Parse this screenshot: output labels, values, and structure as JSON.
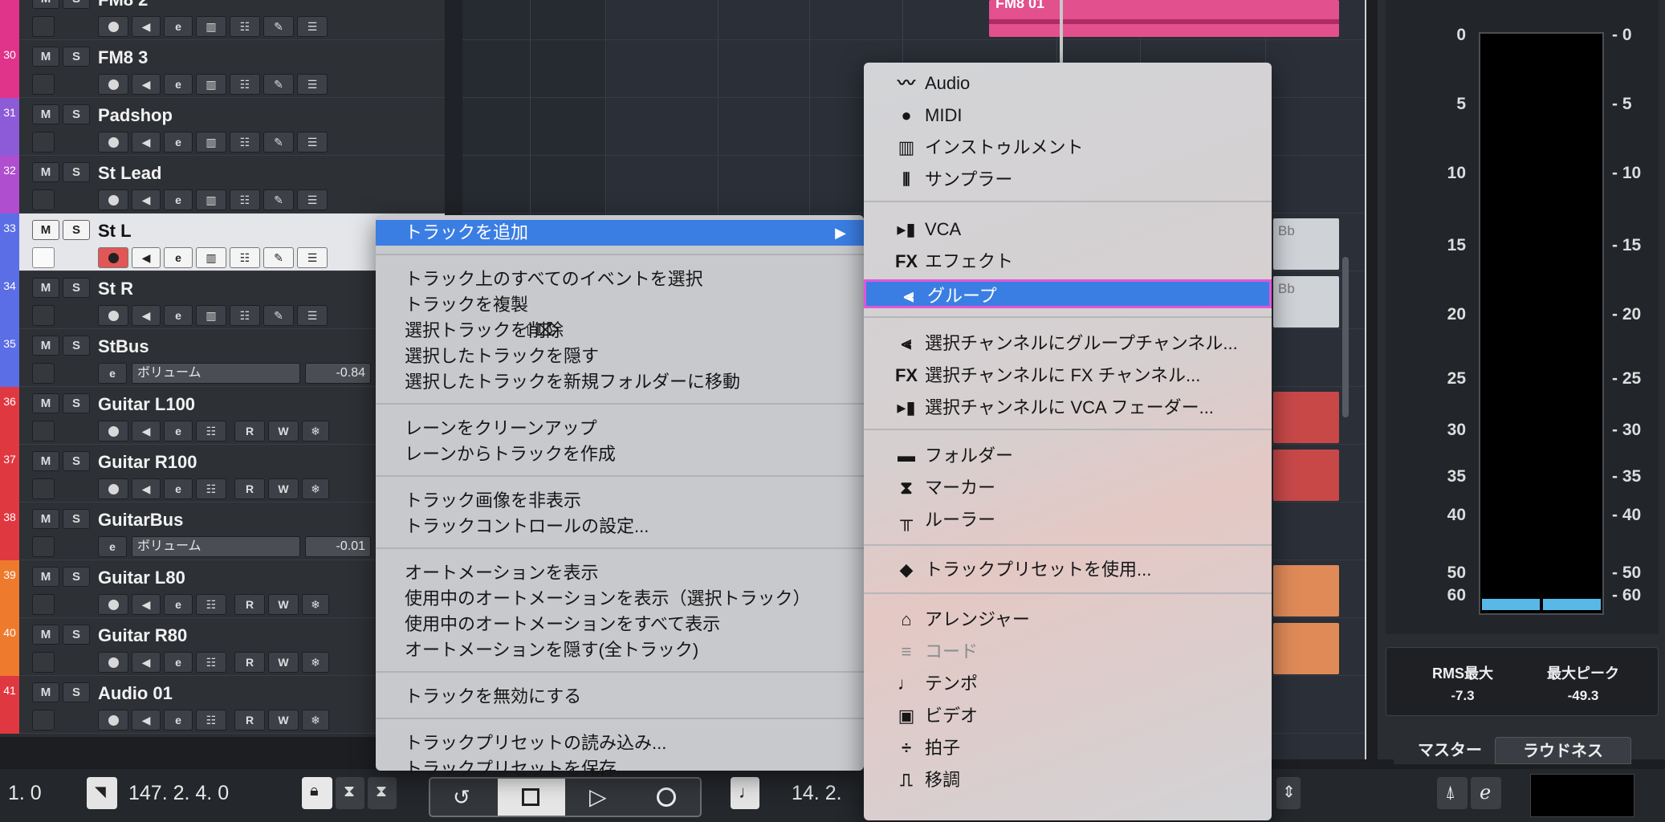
{
  "tracks": [
    {
      "num": "",
      "name": "FM8 2",
      "color": "#e0338a"
    },
    {
      "num": "30",
      "name": "FM8 3",
      "color": "#e0338a"
    },
    {
      "num": "31",
      "name": "Padshop",
      "color": "#8e5bd8"
    },
    {
      "num": "32",
      "name": "St Lead",
      "color": "#b04ed0"
    },
    {
      "num": "33",
      "name": "St L",
      "color": "#5b6ee6"
    },
    {
      "num": "34",
      "name": "St R",
      "color": "#5b6ee6"
    },
    {
      "num": "35",
      "name": "StBus",
      "color": "#5b6ee6",
      "volume_label": "ボリューム",
      "volume_value": "-0.84"
    },
    {
      "num": "36",
      "name": "Guitar L100",
      "color": "#e03840"
    },
    {
      "num": "37",
      "name": "Guitar R100",
      "color": "#e03840"
    },
    {
      "num": "38",
      "name": "GuitarBus",
      "color": "#e03840",
      "volume_label": "ボリューム",
      "volume_value": "-0.01"
    },
    {
      "num": "39",
      "name": "Guitar L80",
      "color": "#ee7a2e"
    },
    {
      "num": "40",
      "name": "Guitar R80",
      "color": "#ee7a2e"
    },
    {
      "num": "41",
      "name": "Audio 01",
      "color": "#e03840"
    }
  ],
  "track_buttons": {
    "mute": "M",
    "solo": "S",
    "e": "e",
    "read": "R",
    "write": "W"
  },
  "project": {
    "event_top_label": "FM8 01",
    "event_bb_1": "Bb",
    "event_bb_2": "Bb"
  },
  "context_menu": {
    "items": [
      {
        "label": "トラックを追加",
        "highlighted": true
      },
      {
        "label": "トラック上のすべてのイベントを選択"
      },
      {
        "label": "トラックを複製"
      },
      {
        "label": "選択トラックを削除",
        "shortcut": "⇧⌦"
      },
      {
        "label": "選択したトラックを隠す"
      },
      {
        "label": "選択したトラックを新規フォルダーに移動"
      },
      {
        "label": "レーンをクリーンアップ"
      },
      {
        "label": "レーンからトラックを作成"
      },
      {
        "label": "トラック画像を非表示"
      },
      {
        "label": "トラックコントロールの設定..."
      },
      {
        "label": "オートメーションを表示"
      },
      {
        "label": "使用中のオートメーションを表示（選択トラック）"
      },
      {
        "label": "使用中のオートメーションをすべて表示"
      },
      {
        "label": "オートメーションを隠す(全トラック)"
      },
      {
        "label": "トラックを無効にする"
      },
      {
        "label": "トラックプリセットの読み込み..."
      },
      {
        "label": "トラックプリセットを保存..."
      }
    ],
    "arrow": "▶"
  },
  "submenu": {
    "items": [
      {
        "label": "Audio",
        "icon": "waveform-icon",
        "glyph": "〰"
      },
      {
        "label": "MIDI",
        "icon": "midi-icon",
        "glyph": "●"
      },
      {
        "label": "インストゥルメント",
        "icon": "piano-icon",
        "glyph": "▥"
      },
      {
        "label": "サンプラー",
        "icon": "sampler-icon",
        "glyph": "⦀"
      },
      {
        "label": "VCA",
        "icon": "vca-icon",
        "glyph": "▸▮"
      },
      {
        "label": "エフェクト",
        "icon": "fx-icon",
        "glyph": "FX"
      },
      {
        "label": "グループ",
        "icon": "group-icon",
        "glyph": "⫷",
        "highlighted": true
      },
      {
        "label": "選択チャンネルにグループチャンネル...",
        "icon": "group-icon",
        "glyph": "⫷"
      },
      {
        "label": "選択チャンネルに FX チャンネル...",
        "icon": "fx-icon",
        "glyph": "FX"
      },
      {
        "label": "選択チャンネルに VCA フェーダー...",
        "icon": "vca-icon",
        "glyph": "▸▮"
      },
      {
        "label": "フォルダー",
        "icon": "folder-icon",
        "glyph": "▬"
      },
      {
        "label": "マーカー",
        "icon": "marker-icon",
        "glyph": "⧗"
      },
      {
        "label": "ルーラー",
        "icon": "ruler-icon",
        "glyph": "╥"
      },
      {
        "label": "トラックプリセットを使用...",
        "icon": "preset-icon",
        "glyph": "◆"
      },
      {
        "label": "アレンジャー",
        "icon": "arranger-icon",
        "glyph": "⌂"
      },
      {
        "label": "コード",
        "icon": "chord-icon",
        "glyph": "≡",
        "disabled": true
      },
      {
        "label": "テンポ",
        "icon": "tempo-icon",
        "glyph": "♩"
      },
      {
        "label": "ビデオ",
        "icon": "video-icon",
        "glyph": "▣"
      },
      {
        "label": "拍子",
        "icon": "signature-icon",
        "glyph": "÷"
      },
      {
        "label": "移調",
        "icon": "transpose-icon",
        "glyph": "⎍"
      }
    ]
  },
  "meter": {
    "scale_left": [
      "0",
      "5",
      "10",
      "15",
      "20",
      "25",
      "30",
      "35",
      "40",
      "50",
      "60"
    ],
    "scale_right": [
      "- 0",
      "- 5",
      "- 10",
      "- 15",
      "- 20",
      "- 25",
      "- 30",
      "- 35",
      "- 40",
      "- 50",
      "- 60"
    ],
    "rms_label": "RMS最大",
    "rms_value": "-7.3",
    "peak_label": "最大ピーク",
    "peak_value": "-49.3",
    "tab_master": "マスター",
    "tab_loudness": "ラウドネス",
    "bar_color": "#58b9e8"
  },
  "transport": {
    "left_position": "1.   0",
    "locator": "147.  2.  4.    0",
    "right_position": "14.  2."
  }
}
